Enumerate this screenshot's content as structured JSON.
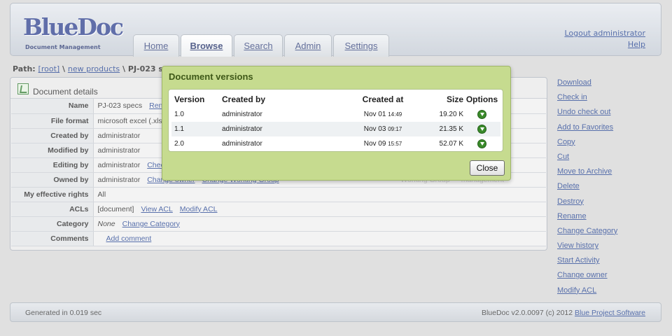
{
  "brand": {
    "logo_text": "BlueDoc",
    "tagline": "Document Management"
  },
  "tabs": [
    {
      "label": "Home"
    },
    {
      "label": "Browse"
    },
    {
      "label": "Search"
    },
    {
      "label": "Admin"
    },
    {
      "label": "Settings"
    }
  ],
  "header_links": {
    "logout": "Logout administrator",
    "help": "Help"
  },
  "path": {
    "label": "Path:",
    "root": "[root]",
    "sep": "\\",
    "folder": "new products",
    "current": "PJ-023 specs"
  },
  "details": {
    "title": "Document details",
    "rows": [
      {
        "label": "Name",
        "value": "PJ-023 specs",
        "links": [
          "Rename"
        ]
      },
      {
        "label": "File format",
        "value": "microsoft excel (.xls)",
        "links": []
      },
      {
        "label": "Created by",
        "value": "administrator",
        "links": []
      },
      {
        "label": "Modified by",
        "value": "administrator",
        "links": []
      },
      {
        "label": "Editing by",
        "value": "administrator",
        "links": [
          "Check in"
        ]
      },
      {
        "label": "Owned by",
        "value": "administrator",
        "links": [
          "Change owner",
          "Change Working Group"
        ],
        "extra_label": "Working Group",
        "extra_value": "management"
      },
      {
        "label": "My effective rights",
        "value": "All",
        "links": []
      },
      {
        "label": "ACLs",
        "value": "[document]",
        "links": [
          "View ACL",
          "Modify ACL"
        ]
      },
      {
        "label": "Category",
        "value": "None",
        "links": [
          "Change Category"
        ]
      },
      {
        "label": "Comments",
        "value": "",
        "links": [
          "Add comment"
        ]
      }
    ]
  },
  "sidebar": {
    "items": [
      "Download",
      "Check in",
      "Undo check out",
      "Add to Favorites",
      "Copy",
      "Cut",
      "Move to Archive",
      "Delete",
      "Destroy",
      "Rename",
      "Change Category",
      "View history",
      "Start Activity",
      "Change owner",
      "Modify ACL"
    ]
  },
  "footer": {
    "generated": "Generated in 0.019 sec",
    "copyright": "BlueDoc v2.0.0097 (c) 2012",
    "company": "Blue Project Software"
  },
  "modal": {
    "title": "Document versions",
    "columns": {
      "version": "Version",
      "created_by": "Created by",
      "created_at": "Created at",
      "size": "Size",
      "options": "Options"
    },
    "rows": [
      {
        "version": "1.0",
        "created_by": "administrator",
        "date": "Nov 01",
        "time": "14:49",
        "size": "19.20 K",
        "option_icon": "download-icon"
      },
      {
        "version": "1.1",
        "created_by": "administrator",
        "date": "Nov 03",
        "time": "09:17",
        "size": "21.35 K",
        "option_icon": "download-icon"
      },
      {
        "version": "2.0",
        "created_by": "administrator",
        "date": "Nov 09",
        "time": "15:57",
        "size": "52.07 K",
        "option_icon": "download-icon"
      }
    ],
    "close_label": "Close"
  },
  "colors": {
    "modal_bg": "#c6db8f",
    "link": "#1f3f8f",
    "brand": "#2b3e8c"
  }
}
